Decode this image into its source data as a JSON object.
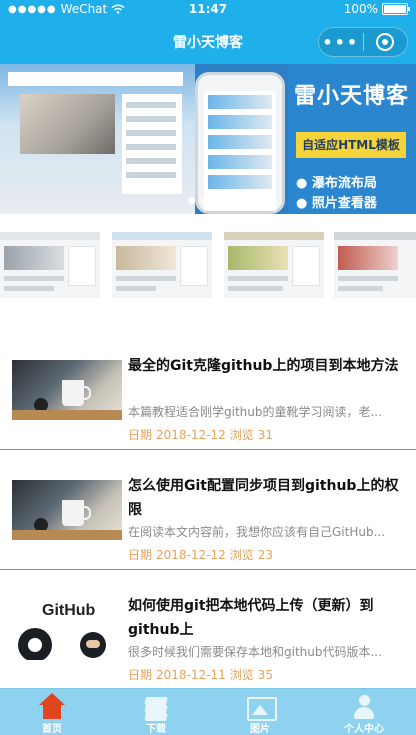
{
  "status_bar": {
    "signal": "●●●●●",
    "carrier": "WeChat",
    "time": "11:47",
    "battery": "100%"
  },
  "nav": {
    "title": "雷小天博客",
    "more_glyph": "•••"
  },
  "banner": {
    "title": "雷小天博客",
    "box": "自适应HTML模板",
    "line1": "● 瀑布流布局",
    "line2": "● 照片查看器"
  },
  "articles": [
    {
      "title": "最全的Git克隆github上的项目到本地方法",
      "desc": "本篇教程适合刚学github的童靴学习阅读，老...",
      "date_label": "日期",
      "date": "2018-12-12",
      "views_label": "浏览",
      "views": "31"
    },
    {
      "title": "怎么使用Git配置同步项目到github上的权限",
      "desc": "在阅读本文内容前，我想你应该有自己GitHub...",
      "date_label": "日期",
      "date": "2018-12-12",
      "views_label": "浏览",
      "views": "23"
    },
    {
      "title": "如何使用git把本地代码上传（更新）到github上",
      "desc": "很多时候我们需要保存本地和github代码版本...",
      "date_label": "日期",
      "date": "2018-12-11",
      "views_label": "浏览",
      "views": "35",
      "thumb_text": "GitHub"
    }
  ],
  "tabbar": {
    "items": [
      {
        "label": "首页",
        "icon": "home-icon",
        "active": true
      },
      {
        "label": "下载",
        "icon": "layers-icon",
        "active": false
      },
      {
        "label": "图片",
        "icon": "image-icon",
        "active": false
      },
      {
        "label": "个人中心",
        "icon": "user-icon",
        "active": false
      }
    ]
  },
  "colors": {
    "header": "#1fb0ec",
    "tabbar": "#8ed2ef",
    "meta": "#e5a35a",
    "home_active": "#e0451f"
  }
}
